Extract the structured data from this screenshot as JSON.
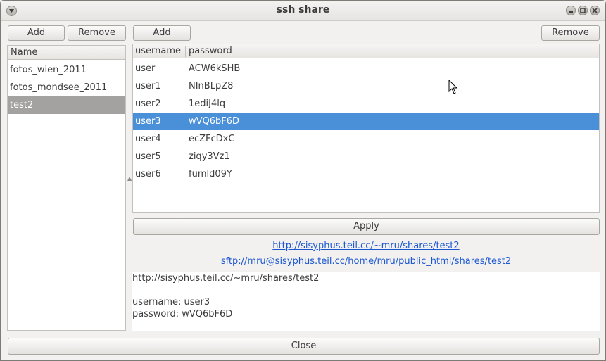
{
  "window": {
    "title": "ssh share"
  },
  "left": {
    "add_label": "Add",
    "remove_label": "Remove",
    "header": "Name",
    "items": [
      "fotos_wien_2011",
      "fotos_mondsee_2011",
      "test2"
    ],
    "selected_index": 2
  },
  "right": {
    "add_label": "Add",
    "remove_label": "Remove",
    "columns": [
      "username",
      "password"
    ],
    "rows": [
      [
        "user",
        "ACW6kSHB"
      ],
      [
        "user1",
        "NInBLpZ8"
      ],
      [
        "user2",
        "1ediJ4lq"
      ],
      [
        "user3",
        "wVQ6bF6D"
      ],
      [
        "user4",
        "ecZFcDxC"
      ],
      [
        "user5",
        "ziqy3Vz1"
      ],
      [
        "user6",
        "fumld09Y"
      ]
    ],
    "selected_index": 3
  },
  "apply_label": "Apply",
  "links": {
    "http": "http://sisyphus.teil.cc/~mru/shares/test2",
    "sftp": "sftp://mru@sisyphus.teil.cc/home/mru/public_html/shares/test2"
  },
  "info": {
    "url": "http://sisyphus.teil.cc/~mru/shares/test2",
    "username_line": "username: user3",
    "password_line": "password: wVQ6bF6D"
  },
  "close_label": "Close",
  "colors": {
    "selection_blue": "#4a90d9",
    "selection_gray": "#a3a2a0",
    "link": "#1b57d1"
  }
}
